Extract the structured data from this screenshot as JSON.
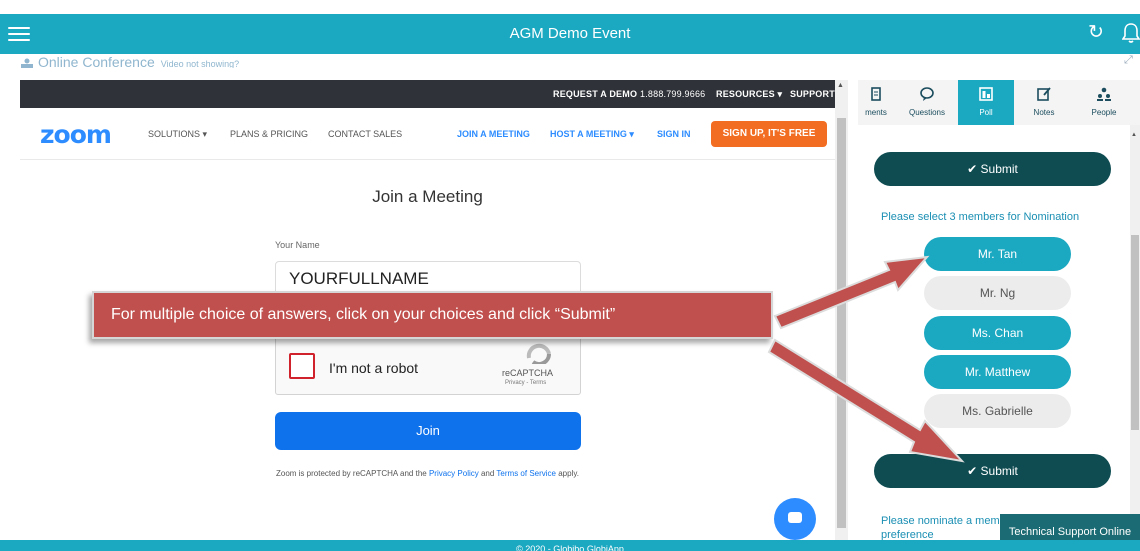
{
  "app": {
    "title": "AGM Demo Event",
    "conference_label": "Online Conference",
    "video_hint": "Video not showing?",
    "footer_text": "© 2020 - Globibo GlobiApp",
    "support_label": "Technical Support Online"
  },
  "zoom": {
    "topbar": {
      "request_demo": "REQUEST A DEMO",
      "phone": "1.888.799.9666",
      "resources": "RESOURCES ▾",
      "support": "SUPPORT"
    },
    "nav": {
      "logo": "zoom",
      "solutions": "SOLUTIONS ▾",
      "plans": "PLANS & PRICING",
      "contact": "CONTACT SALES",
      "join": "JOIN A MEETING",
      "host": "HOST A MEETING ▾",
      "signin": "SIGN IN",
      "signup": "SIGN UP, IT'S FREE"
    },
    "heading": "Join a Meeting",
    "name_label": "Your Name",
    "name_value": "YOURFULLNAME",
    "recaptcha": {
      "text": "I'm not a robot",
      "brand": "reCAPTCHA",
      "privacy_terms": "Privacy - Terms"
    },
    "join_button": "Join",
    "disclaimer": {
      "prefix": "Zoom is protected by reCAPTCHA and the",
      "privacy": "Privacy Policy",
      "and": "and",
      "terms": "Terms of Service",
      "suffix": "apply."
    }
  },
  "panel": {
    "tabs": [
      {
        "label": "ments",
        "icon": "document-icon"
      },
      {
        "label": "Questions",
        "icon": "chat-bubble-icon"
      },
      {
        "label": "Poll",
        "icon": "poll-icon",
        "active": true
      },
      {
        "label": "Notes",
        "icon": "edit-note-icon"
      },
      {
        "label": "People",
        "icon": "people-icon"
      }
    ],
    "submit_label": "✔ Submit",
    "question_1": "Please select 3 members for Nomination",
    "choices": [
      {
        "label": "Mr. Tan",
        "selected": true
      },
      {
        "label": "Mr. Ng",
        "selected": false
      },
      {
        "label": "Ms. Chan",
        "selected": true
      },
      {
        "label": "Mr. Matthew",
        "selected": true
      },
      {
        "label": "Ms. Gabrielle",
        "selected": false
      }
    ],
    "question_2": "Please nominate a member of preference"
  },
  "callout": {
    "text": "For multiple choice of answers, click on your choices and click “Submit”"
  },
  "colors": {
    "accent": "#1ba8c1",
    "submit": "#0e4c52",
    "callout": "#c0504d",
    "zoom_blue": "#2d8cff",
    "zoom_orange": "#f26d21"
  }
}
